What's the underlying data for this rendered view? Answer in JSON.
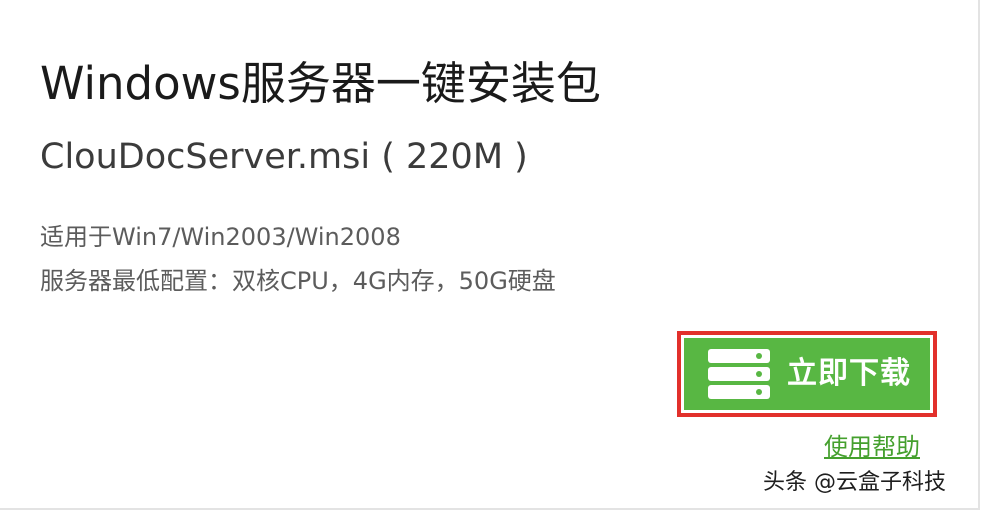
{
  "product": {
    "title": "Windows服务器一键安装包",
    "file_label": "ClouDocServer.msi ( 220M )"
  },
  "requirements": {
    "compat": "适用于Win7/Win2003/Win2008",
    "specs": "服务器最低配置：双核CPU，4G内存，50G硬盘"
  },
  "actions": {
    "download_label": "立即下载",
    "download_icon": "server-icon",
    "help_label": "使用帮助"
  },
  "watermark": "头条 @云盒子科技",
  "colors": {
    "button_green": "#58b743",
    "highlight_red": "#e2302b",
    "link_green": "#45a02e"
  }
}
